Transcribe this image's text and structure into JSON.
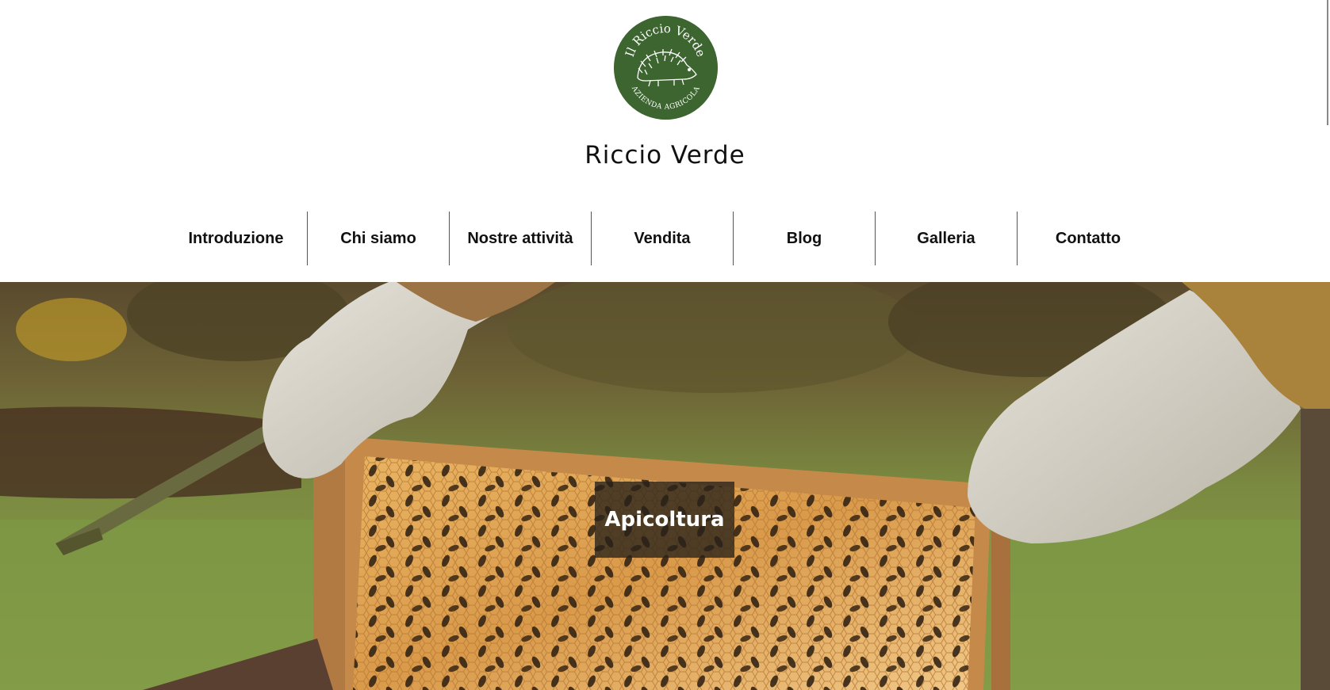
{
  "logo": {
    "top_text": "Il Riccio Verde",
    "bottom_text": "AZIENDA AGRICOLA",
    "icon": "hedgehog-icon",
    "color": "#3c6530"
  },
  "site": {
    "title": "Riccio Verde"
  },
  "nav": {
    "items": [
      {
        "label": "Introduzione"
      },
      {
        "label": "Chi siamo"
      },
      {
        "label": "Nostre attività"
      },
      {
        "label": "Vendita"
      },
      {
        "label": "Blog"
      },
      {
        "label": "Galleria"
      },
      {
        "label": "Contatto"
      }
    ]
  },
  "hero": {
    "caption": "Apicoltura"
  }
}
